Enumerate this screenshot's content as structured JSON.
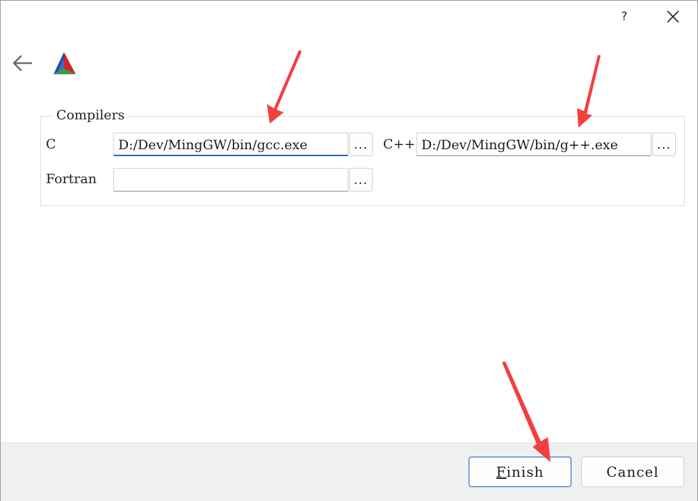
{
  "titlebar": {
    "help_label": "?"
  },
  "group": {
    "title": "Compilers"
  },
  "fields": {
    "c": {
      "label": "C",
      "value": "D:/Dev/MingGW/bin/gcc.exe",
      "browse_label": "..."
    },
    "cpp": {
      "label": "C++",
      "value": "D:/Dev/MingGW/bin/g++.exe",
      "browse_label": "..."
    },
    "fortran": {
      "label": "Fortran",
      "value": "",
      "browse_label": "..."
    }
  },
  "footer": {
    "finish_mnemonic": "F",
    "finish_rest": "inish",
    "cancel_label": "Cancel"
  },
  "colors": {
    "focus_accent": "#1e63b6",
    "annotation_arrow": "#f43f3f",
    "footer_bg": "#f0f0f0"
  },
  "icons": [
    "back-arrow-icon",
    "cmake-logo-icon",
    "close-icon"
  ]
}
